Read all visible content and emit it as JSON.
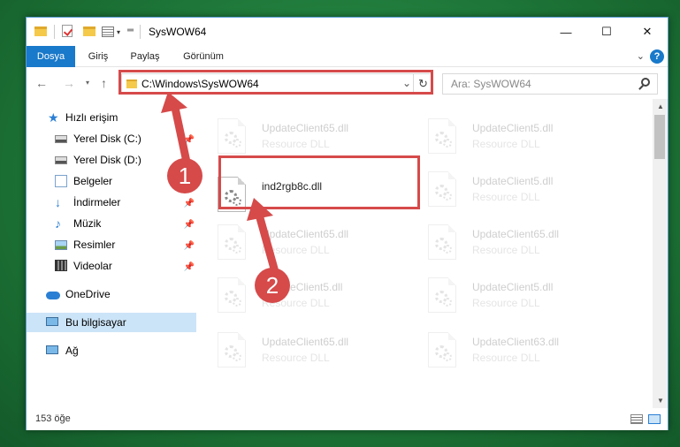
{
  "window": {
    "title": "SysWOW64"
  },
  "ribbon": {
    "tabs": [
      "Dosya",
      "Giriş",
      "Paylaş",
      "Görünüm"
    ]
  },
  "address": {
    "path": "C:\\Windows\\SysWOW64"
  },
  "search": {
    "placeholder": "Ara: SysWOW64"
  },
  "sidebar": {
    "items": [
      {
        "label": "Hızlı erişim",
        "icon": "star-icon",
        "pinned": false
      },
      {
        "label": "Yerel Disk (C:)",
        "icon": "disk-icon",
        "pinned": true
      },
      {
        "label": "Yerel Disk (D:)",
        "icon": "disk-icon",
        "pinned": false
      },
      {
        "label": "Belgeler",
        "icon": "document-icon",
        "pinned": false
      },
      {
        "label": "İndirmeler",
        "icon": "download-icon",
        "pinned": true
      },
      {
        "label": "Müzik",
        "icon": "music-icon",
        "pinned": true
      },
      {
        "label": "Resimler",
        "icon": "picture-icon",
        "pinned": true
      },
      {
        "label": "Videolar",
        "icon": "video-icon",
        "pinned": true
      },
      {
        "label": "OneDrive",
        "icon": "cloud-icon",
        "pinned": false
      },
      {
        "label": "Bu bilgisayar",
        "icon": "computer-icon",
        "pinned": false,
        "selected": true
      },
      {
        "label": "Ağ",
        "icon": "network-icon",
        "pinned": false
      }
    ]
  },
  "files": [
    {
      "name": "UpdateClient65.dll",
      "type": "Resource DLL"
    },
    {
      "name": "UpdateClient5.dll",
      "type": "Resource DLL"
    },
    {
      "name": "ind2rgb8c.dll",
      "type": ""
    },
    {
      "name": "UpdateClient5.dll",
      "type": "Resource DLL"
    },
    {
      "name": "UpdateClient65.dll",
      "type": "Resource DLL"
    },
    {
      "name": "UpdateClient65.dll",
      "type": "Resource DLL"
    },
    {
      "name": "UpdateClient5.dll",
      "type": "Resource DLL"
    },
    {
      "name": "UpdateClient5.dll",
      "type": "Resource DLL"
    },
    {
      "name": "UpdateClient65.dll",
      "type": "Resource DLL"
    },
    {
      "name": "UpdateClient63.dll",
      "type": "Resource DLL"
    }
  ],
  "status": {
    "count": "153 öğe"
  },
  "annotations": {
    "step1": "1",
    "step2": "2"
  },
  "colors": {
    "accent": "#1979ca",
    "highlight": "#d64a4a",
    "background": "#1f7a3a"
  }
}
